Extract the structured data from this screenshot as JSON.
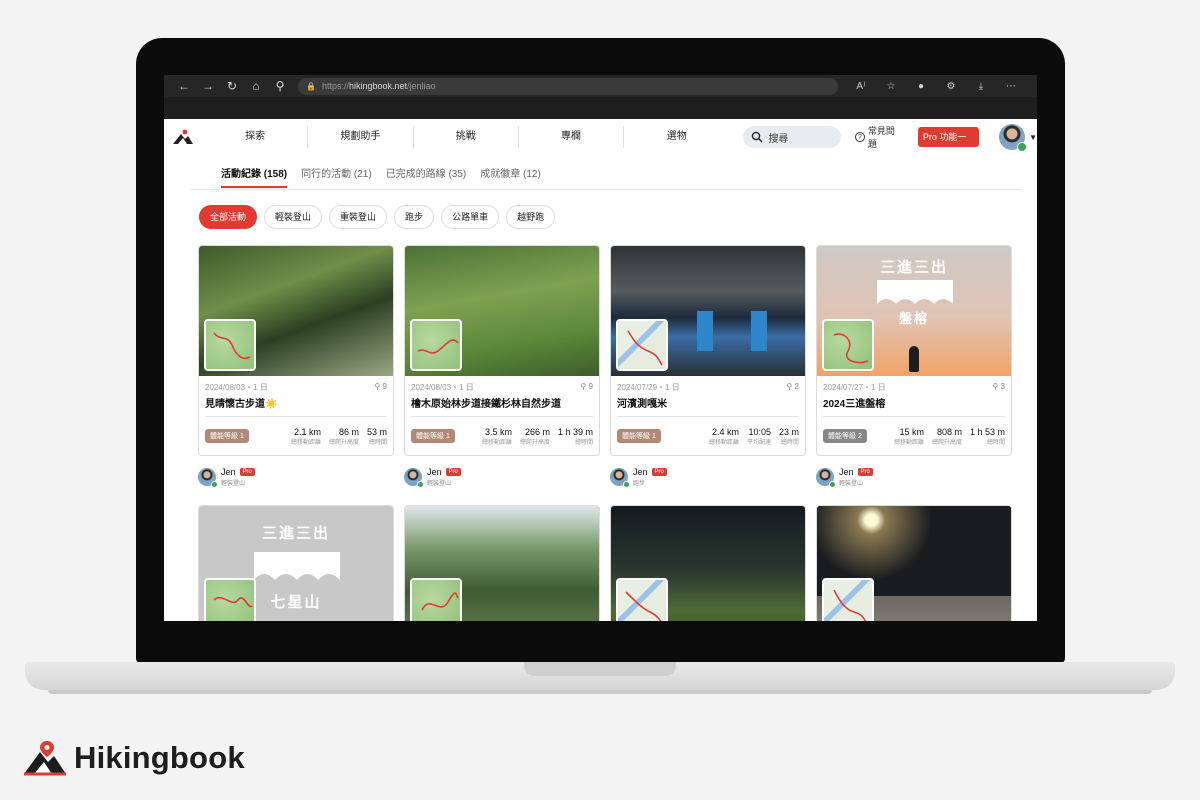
{
  "browser": {
    "url_prefix": "https://",
    "url_host": "hikingbook.net",
    "url_path": "/jenliao"
  },
  "header": {
    "nav": [
      "探索",
      "規劃助手",
      "挑戰",
      "專欄",
      "選物"
    ],
    "search_placeholder": "搜尋",
    "faq": "常見問題",
    "pro_button": "Pro 功能一覽"
  },
  "tabs": [
    {
      "label": "活動紀錄 (158)",
      "active": true
    },
    {
      "label": "同行的活動 (21)"
    },
    {
      "label": "已完成的路線 (35)"
    },
    {
      "label": "成就徽章 (12)"
    }
  ],
  "filters": [
    "全部活動",
    "輕裝登山",
    "重裝登山",
    "跑步",
    "公路單車",
    "越野跑"
  ],
  "cards": [
    {
      "date": "2024/08/03・1 日",
      "pins": "9",
      "title": "見晴懷古步道☀️",
      "grade": "體能等級 1",
      "stats": [
        {
          "v": "2.1 km",
          "l": "總移動距離"
        },
        {
          "v": "86 m",
          "l": "總爬升高度"
        },
        {
          "v": "53 m",
          "l": "總時間"
        }
      ],
      "user": "Jen",
      "pro": "Pro",
      "activity": "輕裝登山"
    },
    {
      "date": "2024/08/03・1 日",
      "pins": "9",
      "title": "檜木原始林步道接鐵杉林自然步道",
      "grade": "體能等級 1",
      "stats": [
        {
          "v": "3.5 km",
          "l": "總移動距離"
        },
        {
          "v": "266 m",
          "l": "總爬升高度"
        },
        {
          "v": "1 h 39 m",
          "l": "總時間"
        }
      ],
      "user": "Jen",
      "pro": "Pro",
      "activity": "輕裝登山"
    },
    {
      "date": "2024/07/29・1 日",
      "pins": "2",
      "title": "河濱測嘎米",
      "grade": "體能等級 1",
      "stats": [
        {
          "v": "2.4 km",
          "l": "總移動距離"
        },
        {
          "v": "10:05",
          "l": "平均配速"
        },
        {
          "v": "23 m",
          "l": "總時間"
        }
      ],
      "user": "Jen",
      "pro": "Pro",
      "activity": "跑步"
    },
    {
      "date": "2024/07/27・1 日",
      "pins": "3",
      "title": "2024三進盤榕",
      "grade": "體能等級 2",
      "stats": [
        {
          "v": "15 km",
          "l": "總移動距離"
        },
        {
          "v": "808 m",
          "l": "總爬升高度"
        },
        {
          "v": "1 h 53 m",
          "l": "總時間"
        }
      ],
      "user": "Jen",
      "pro": "Pro",
      "activity": "輕裝登山",
      "overlay_top": "三進三出",
      "overlay_bottom": "盤榕"
    }
  ],
  "second_row": {
    "overlay_top": "三進三出",
    "overlay_bottom": "七星山"
  },
  "brand": {
    "name": "Hikingbook"
  },
  "colors": {
    "accent": "#e03b33",
    "grade_brown": "#b08a77",
    "grade_gray": "#888888"
  }
}
